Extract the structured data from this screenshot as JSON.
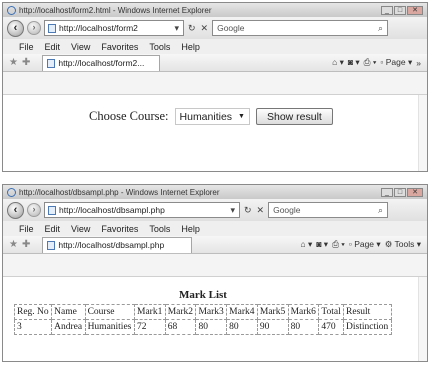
{
  "window1": {
    "title": "http://localhost/form2.html - Windows Internet Explorer",
    "address": "http://localhost/form2",
    "search_placeholder": "Google",
    "menu": [
      "File",
      "Edit",
      "View",
      "Favorites",
      "Tools",
      "Help"
    ],
    "tab_title": "http://localhost/form2...",
    "page_label": "Page",
    "form": {
      "label": "Choose Course:",
      "selected": "Humanities",
      "button": "Show result"
    }
  },
  "window2": {
    "title": "http://localhost/dbsampl.php - Windows Internet Explorer",
    "address": "http://localhost/dbsampl.php",
    "search_placeholder": "Google",
    "menu": [
      "File",
      "Edit",
      "View",
      "Favorites",
      "Tools",
      "Help"
    ],
    "tab_title": "http://localhost/dbsampl.php",
    "page_label": "Page",
    "tools_label": "Tools",
    "table": {
      "caption": "Mark List",
      "headers": [
        "Reg. No",
        "Name",
        "Course",
        "Mark1",
        "Mark2",
        "Mark3",
        "Mark4",
        "Mark5",
        "Mark6",
        "Total",
        "Result"
      ],
      "rows": [
        [
          "3",
          "Andrea",
          "Humanities",
          "72",
          "68",
          "80",
          "80",
          "90",
          "80",
          "470",
          "Distinction"
        ]
      ]
    }
  }
}
